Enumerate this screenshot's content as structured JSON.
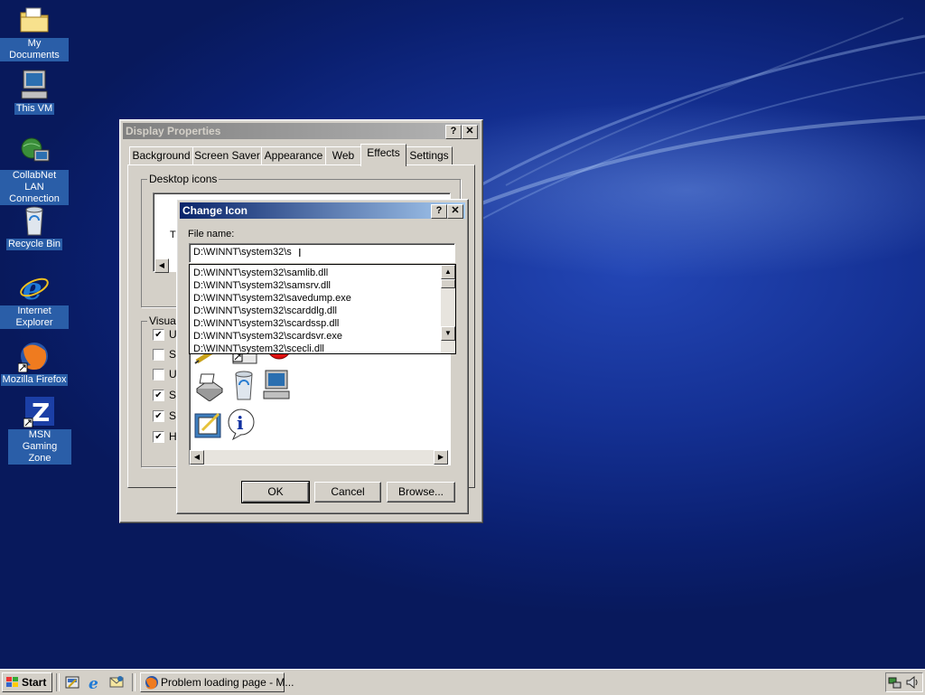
{
  "desktop": {
    "icons": [
      {
        "label": "My Documents",
        "icon": "folder-documents-icon"
      },
      {
        "label": "This VM",
        "icon": "computer-icon"
      },
      {
        "label": "CollabNet LAN Connection",
        "icon": "network-connection-icon"
      },
      {
        "label": "Recycle Bin",
        "icon": "recycle-bin-icon"
      },
      {
        "label": "Internet Explorer",
        "icon": "internet-explorer-icon"
      },
      {
        "label": "Mozilla Firefox",
        "icon": "firefox-icon"
      },
      {
        "label": "MSN Gaming Zone",
        "icon": "msn-gaming-zone-icon"
      }
    ]
  },
  "display_properties": {
    "title": "Display Properties",
    "help_btn": "?",
    "close_btn": "✕",
    "tabs": [
      "Background",
      "Screen Saver",
      "Appearance",
      "Web",
      "Effects",
      "Settings"
    ],
    "selected_tab": "Effects",
    "desktop_icons_group": "Desktop icons",
    "desktop_icon_fragment": "T",
    "visual_group": "Visual",
    "visual_options": [
      {
        "label": "U",
        "checked": true
      },
      {
        "label": "Sr",
        "checked": false
      },
      {
        "label": "U",
        "checked": false
      },
      {
        "label": "Sl",
        "checked": true
      },
      {
        "label": "Sl",
        "checked": true
      },
      {
        "label": "H",
        "checked": true
      }
    ]
  },
  "change_icon": {
    "title": "Change Icon",
    "help_btn": "?",
    "close_btn": "✕",
    "file_name_label": "File name:",
    "file_name_value": "D:\\WINNT\\system32\\s",
    "suggestions": [
      "D:\\WINNT\\system32\\samlib.dll",
      "D:\\WINNT\\system32\\samsrv.dll",
      "D:\\WINNT\\system32\\savedump.exe",
      "D:\\WINNT\\system32\\scarddlg.dll",
      "D:\\WINNT\\system32\\scardssp.dll",
      "D:\\WINNT\\system32\\scardsvr.exe",
      "D:\\WINNT\\system32\\scecli.dll"
    ],
    "icons": [
      "pencil-icon",
      "shortcut-icon",
      "stop-icon",
      "printer-icon",
      "recycle-bin-icon",
      "computer-icon",
      "notepad-icon",
      "info-icon"
    ],
    "ok": "OK",
    "cancel": "Cancel",
    "browse": "Browse..."
  },
  "taskbar": {
    "start": "Start",
    "quick_launch": [
      "show-desktop-icon",
      "internet-explorer-icon",
      "outlook-icon"
    ],
    "task": "Problem loading page - M...",
    "tray": [
      "network-tray-icon",
      "volume-icon"
    ]
  }
}
